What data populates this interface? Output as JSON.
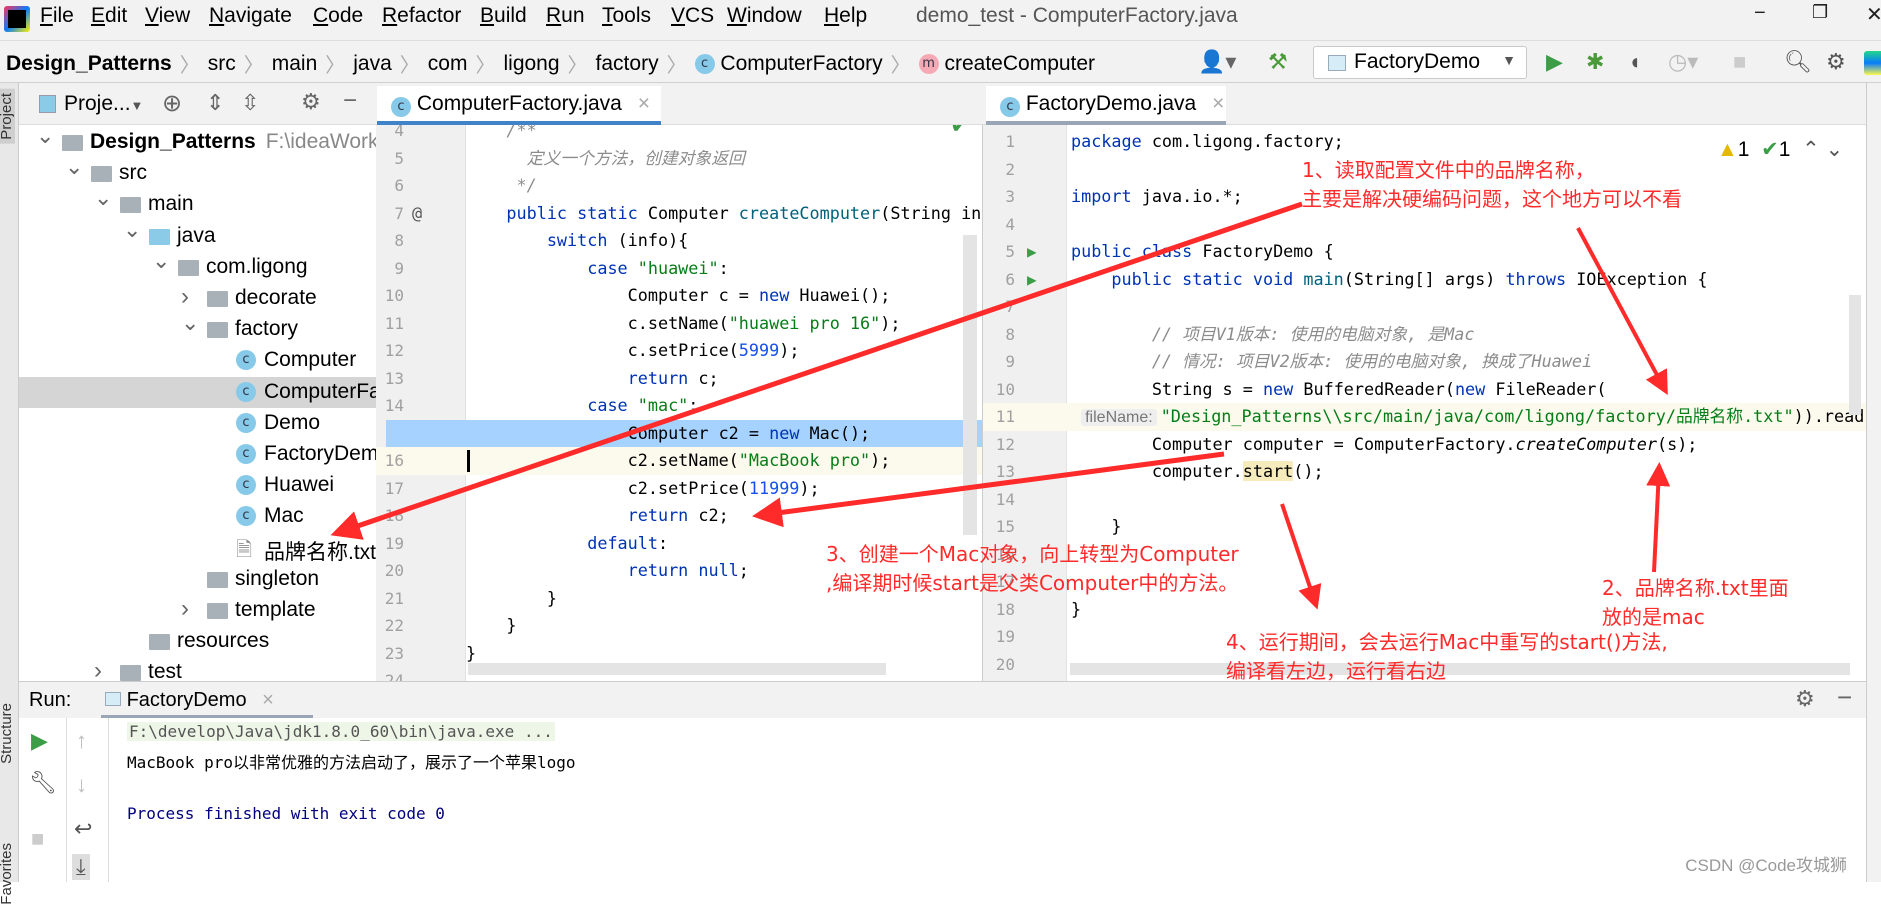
{
  "menu": [
    "File",
    "Edit",
    "View",
    "Navigate",
    "Code",
    "Refactor",
    "Build",
    "Run",
    "Tools",
    "VCS",
    "Window",
    "Help"
  ],
  "window_title": "demo_test - ComputerFactory.java",
  "breadcrumb": [
    "Design_Patterns",
    "src",
    "main",
    "java",
    "com",
    "ligong",
    "factory",
    "ComputerFactory",
    "createComputer"
  ],
  "toolbar": {
    "run_config": "FactoryDemo"
  },
  "project_panel": {
    "title": "Proje...",
    "strip_label": "Project"
  },
  "tree": [
    {
      "label": "Design_Patterns",
      "sub": "F:\\ideaWork",
      "level": 0,
      "arrow": "down",
      "icon": "module",
      "bold": true
    },
    {
      "label": "src",
      "level": 1,
      "arrow": "down",
      "icon": "folder"
    },
    {
      "label": "main",
      "level": 2,
      "arrow": "down",
      "icon": "folder"
    },
    {
      "label": "java",
      "level": 3,
      "arrow": "down",
      "icon": "source-folder"
    },
    {
      "label": "com.ligong",
      "level": 4,
      "arrow": "down",
      "icon": "package"
    },
    {
      "label": "decorate",
      "level": 5,
      "arrow": "right",
      "icon": "package"
    },
    {
      "label": "factory",
      "level": 5,
      "arrow": "down",
      "icon": "package"
    },
    {
      "label": "Computer",
      "level": 6,
      "icon": "abstract-class"
    },
    {
      "label": "ComputerFa",
      "level": 6,
      "icon": "class",
      "selected": true
    },
    {
      "label": "Demo",
      "level": 6,
      "icon": "class"
    },
    {
      "label": "FactoryDem",
      "level": 6,
      "icon": "runnable-class"
    },
    {
      "label": "Huawei",
      "level": 6,
      "icon": "class"
    },
    {
      "label": "Mac",
      "level": 6,
      "icon": "class"
    },
    {
      "label": "品牌名称.txt",
      "level": 6,
      "icon": "text-file"
    },
    {
      "label": "singleton",
      "level": 5,
      "icon": "package"
    },
    {
      "label": "template",
      "level": 5,
      "arrow": "right",
      "icon": "package"
    },
    {
      "label": "resources",
      "level": 3,
      "icon": "resources-folder"
    },
    {
      "label": "test",
      "level": 2,
      "arrow": "right",
      "icon": "folder"
    }
  ],
  "tabs": {
    "left": "ComputerFactory.java",
    "right": "FactoryDemo.java"
  },
  "left_editor": {
    "first_line": 4,
    "lines": [
      {
        "n": 4,
        "seg": [
          [
            "c",
            "    /**"
          ]
        ]
      },
      {
        "n": 5,
        "seg": [
          [
            "c",
            "      定义一个方法，创建对象返回"
          ]
        ]
      },
      {
        "n": 6,
        "seg": [
          [
            "c",
            "     */"
          ]
        ]
      },
      {
        "n": 7,
        "seg": [
          [
            "k",
            "    public static "
          ],
          [
            "p",
            "Computer "
          ],
          [
            "m",
            "createComputer"
          ],
          [
            "p",
            "(String info){"
          ]
        ]
      },
      {
        "n": 8,
        "seg": [
          [
            "k",
            "        switch "
          ],
          [
            "p",
            "(info){"
          ]
        ]
      },
      {
        "n": 9,
        "seg": [
          [
            "k",
            "            case "
          ],
          [
            "s",
            "\"huawei\""
          ],
          [
            "p",
            ":"
          ]
        ]
      },
      {
        "n": 10,
        "seg": [
          [
            "p",
            "                Computer c = "
          ],
          [
            "k",
            "new "
          ],
          [
            "p",
            "Huawei();"
          ]
        ]
      },
      {
        "n": 11,
        "seg": [
          [
            "p",
            "                c.setName("
          ],
          [
            "s",
            "\"huawei pro 16\""
          ],
          [
            "p",
            ");"
          ]
        ]
      },
      {
        "n": 12,
        "seg": [
          [
            "p",
            "                c.setPrice("
          ],
          [
            "n",
            "5999"
          ],
          [
            "p",
            ");"
          ]
        ]
      },
      {
        "n": 13,
        "seg": [
          [
            "k",
            "                return "
          ],
          [
            "p",
            "c;"
          ]
        ]
      },
      {
        "n": 14,
        "seg": [
          [
            "k",
            "            case "
          ],
          [
            "s",
            "\"mac\""
          ],
          [
            "p",
            ":"
          ]
        ]
      },
      {
        "n": 15,
        "seg": [
          [
            "p",
            "                Computer c2 = "
          ],
          [
            "k",
            "new "
          ],
          [
            "p",
            "Mac();"
          ]
        ],
        "state": "selected"
      },
      {
        "n": 16,
        "seg": [
          [
            "p",
            "                c2.setName("
          ],
          [
            "s",
            "\"MacBook pro\""
          ],
          [
            "p",
            ");"
          ]
        ],
        "state": "caret"
      },
      {
        "n": 17,
        "seg": [
          [
            "p",
            "                c2.setPrice("
          ],
          [
            "n",
            "11999"
          ],
          [
            "p",
            ");"
          ]
        ]
      },
      {
        "n": 18,
        "seg": [
          [
            "k",
            "                return "
          ],
          [
            "p",
            "c2;"
          ]
        ]
      },
      {
        "n": 19,
        "seg": [
          [
            "k",
            "            default"
          ],
          [
            "p",
            ":"
          ]
        ]
      },
      {
        "n": 20,
        "seg": [
          [
            "k",
            "                return null"
          ],
          [
            "p",
            ";"
          ]
        ]
      },
      {
        "n": 21,
        "seg": [
          [
            "p",
            "        }"
          ]
        ]
      },
      {
        "n": 22,
        "seg": [
          [
            "p",
            "    }"
          ]
        ]
      },
      {
        "n": 23,
        "seg": [
          [
            "p",
            "}"
          ]
        ]
      },
      {
        "n": 24,
        "seg": []
      }
    ]
  },
  "right_editor": {
    "inspections": {
      "warnings": "1",
      "weak_warnings": "1"
    },
    "lines": [
      {
        "n": 1,
        "seg": [
          [
            "k",
            "package "
          ],
          [
            "p",
            "com.ligong.factory;"
          ]
        ]
      },
      {
        "n": 2,
        "seg": []
      },
      {
        "n": 3,
        "seg": [
          [
            "k",
            "import "
          ],
          [
            "p",
            "java.io.*;"
          ]
        ]
      },
      {
        "n": 4,
        "seg": []
      },
      {
        "n": 5,
        "seg": [
          [
            "k",
            "public class "
          ],
          [
            "p",
            "FactoryDemo {"
          ]
        ],
        "run": true
      },
      {
        "n": 6,
        "seg": [
          [
            "k",
            "    public static void "
          ],
          [
            "m",
            "main"
          ],
          [
            "p",
            "(String[] args) "
          ],
          [
            "k",
            "throws "
          ],
          [
            "p",
            "IOException {"
          ]
        ],
        "run": true
      },
      {
        "n": 7,
        "seg": []
      },
      {
        "n": 8,
        "seg": [
          [
            "c",
            "        // 项目V1版本: 使用的电脑对象, 是Mac"
          ]
        ]
      },
      {
        "n": 9,
        "seg": [
          [
            "c",
            "        // 情况: 项目V2版本: 使用的电脑对象, 换成了Huawei"
          ]
        ]
      },
      {
        "n": 10,
        "seg": [
          [
            "p",
            "        String s = "
          ],
          [
            "k",
            "new "
          ],
          [
            "p",
            "BufferedReader("
          ],
          [
            "k",
            "new "
          ],
          [
            "p",
            "FileReader("
          ]
        ]
      },
      {
        "n": 11,
        "seg": [
          [
            "p",
            " "
          ],
          [
            "h",
            "fileName:"
          ],
          [
            "s",
            "\"Design_Patterns\\\\src/main/java/com/ligong/factory/品牌名称.txt\""
          ],
          [
            "p",
            "))"
          ],
          [
            "p",
            ".readLine();"
          ]
        ],
        "state": "caret"
      },
      {
        "n": 12,
        "seg": [
          [
            "p",
            "        Computer computer = ComputerFactory."
          ],
          [
            "i",
            "createComputer"
          ],
          [
            "p",
            "(s);"
          ]
        ]
      },
      {
        "n": 13,
        "seg": [
          [
            "p",
            "        computer."
          ],
          [
            "hl",
            "start"
          ],
          [
            "p",
            "();"
          ]
        ]
      },
      {
        "n": 14,
        "seg": []
      },
      {
        "n": 15,
        "seg": [
          [
            "p",
            "    }"
          ]
        ]
      },
      {
        "n": 16,
        "seg": []
      },
      {
        "n": 17,
        "seg": []
      },
      {
        "n": 18,
        "seg": [
          [
            "p",
            "}"
          ]
        ]
      },
      {
        "n": 19,
        "seg": []
      },
      {
        "n": 20,
        "seg": []
      }
    ]
  },
  "run_panel": {
    "label": "Run:",
    "tab": "FactoryDemo",
    "output": [
      "F:\\develop\\Java\\jdk1.8.0_60\\bin\\java.exe ...",
      "MacBook pro以非常优雅的方法启动了，展示了一个苹果logo",
      "",
      "Process finished with exit code 0"
    ]
  },
  "side_labels": {
    "structure": "Structure",
    "favorites": "Favorites"
  },
  "annotations": {
    "note1": [
      "1、读取配置文件中的品牌名称，",
      "主要是解决硬编码问题，这个地方可以不看"
    ],
    "note2": [
      "2、品牌名称.txt里面",
      "放的是mac"
    ],
    "note3": [
      "3、创建一个Mac对象，向上转型为Computer",
      ",编译期时候start是父类Computer中的方法。"
    ],
    "note4": [
      "4、运行期间，会去运行Mac中重写的start()方法,",
      "编译看左边，运行看右边"
    ]
  },
  "watermark": "CSDN @Code攻城狮",
  "colors": {
    "annotation": "#ff2b2b",
    "accent": "#4083c9",
    "selection": "#a6d2ff",
    "keyword": "#0033b3",
    "string": "#067d17"
  }
}
